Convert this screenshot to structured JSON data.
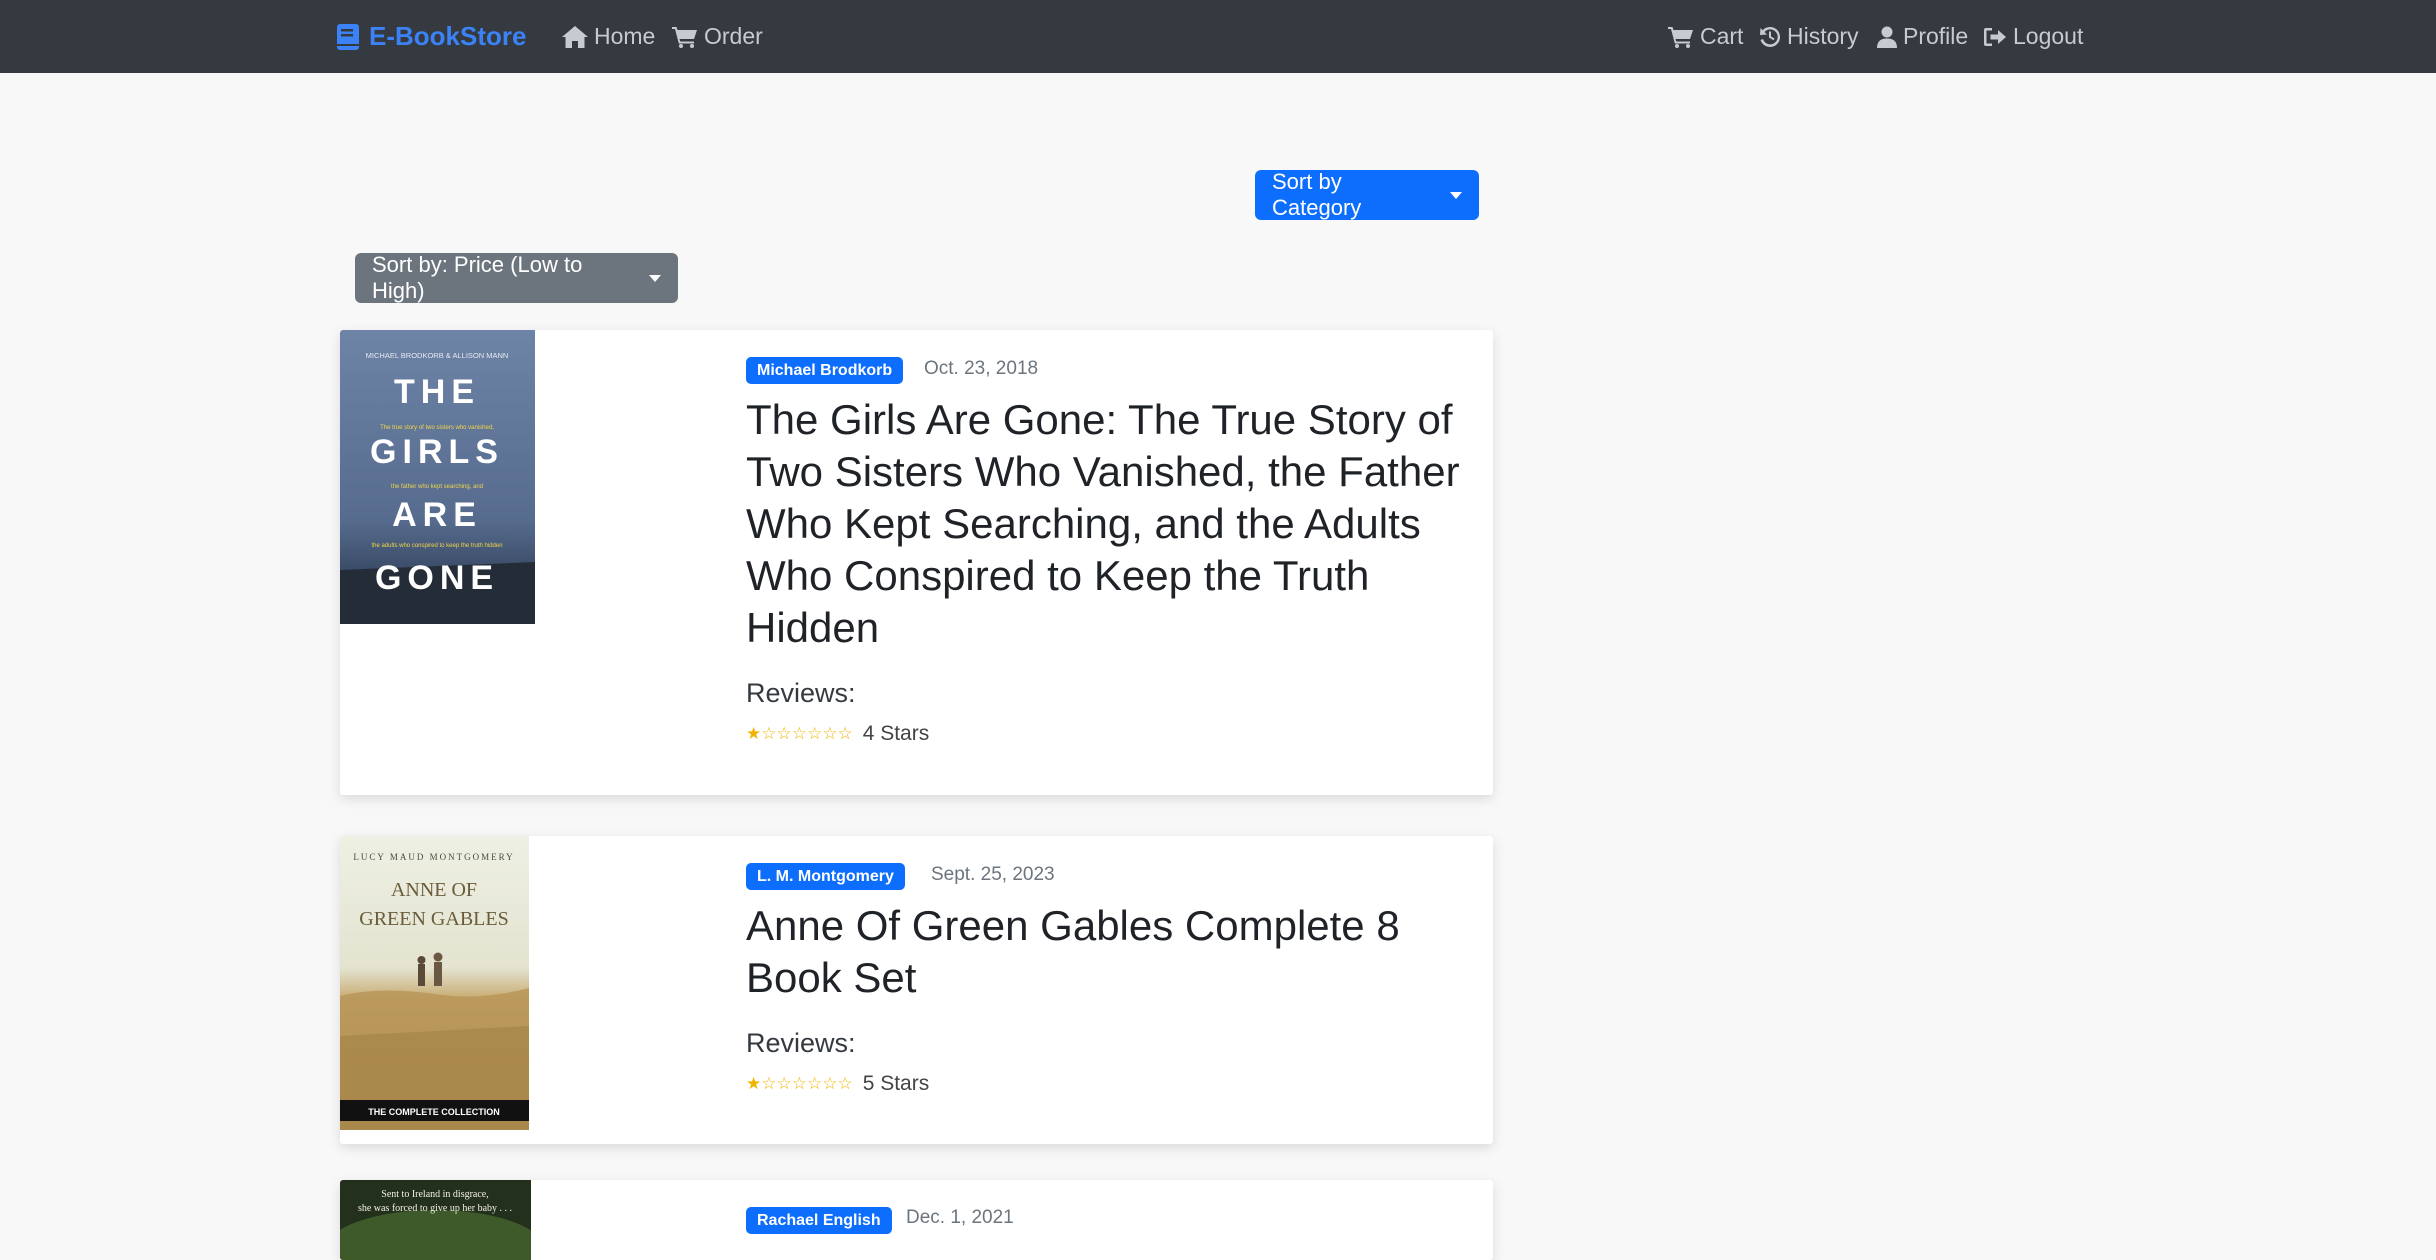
{
  "nav": {
    "brand": "E-BookStore",
    "left_links": [
      {
        "label": "Home",
        "icon": "home-icon"
      },
      {
        "label": "Order",
        "icon": "cart-icon"
      }
    ],
    "right_links": [
      {
        "label": "Cart",
        "icon": "cart-icon"
      },
      {
        "label": "History",
        "icon": "history-icon"
      },
      {
        "label": "Profile",
        "icon": "user-icon"
      },
      {
        "label": "Logout",
        "icon": "logout-icon"
      }
    ]
  },
  "controls": {
    "sort_category": "Sort by Category",
    "sort_price": "Sort by: Price (Low to High)"
  },
  "books": [
    {
      "author": "Michael Brodkorb",
      "date": "Oct. 23, 2018",
      "title": "The Girls Are Gone: The True Story of Two Sisters Who Vanished, the Father Who Kept Searching, and the Adults Who Conspired to Keep the Truth Hidden",
      "reviews_label": "Reviews:",
      "stars_text": "4 Stars",
      "rating": 1,
      "cover": {
        "top_text": "MICHAEL BRODKORB & ALLISON MANN",
        "words": [
          "THE",
          "GIRLS",
          "ARE",
          "GONE"
        ],
        "tagline_1": "The true story of two sisters who vanished,",
        "tagline_2": "the father who kept searching, and",
        "tagline_3": "the adults who conspired to keep the truth hidden"
      }
    },
    {
      "author": "L. M. Montgomery",
      "date": "Sept. 25, 2023",
      "title": "Anne Of Green Gables Complete 8 Book Set",
      "reviews_label": "Reviews:",
      "stars_text": "5 Stars",
      "rating": 1,
      "cover": {
        "top_text": "LUCY MAUD MONTGOMERY",
        "line_1": "ANNE OF",
        "line_2": "GREEN GABLES",
        "bottom_text": "THE COMPLETE COLLECTION"
      }
    },
    {
      "author": "Rachael English",
      "date": "Dec. 1, 2021",
      "cover": {
        "line_1": "Sent to Ireland in disgrace,",
        "line_2": "she was forced to give up her baby . . ."
      }
    }
  ],
  "colors": {
    "navbar": "#343a40",
    "brand": "#3b82f6",
    "primary": "#0d6efd",
    "secondary": "#6c757d",
    "star": "#f0b400"
  }
}
